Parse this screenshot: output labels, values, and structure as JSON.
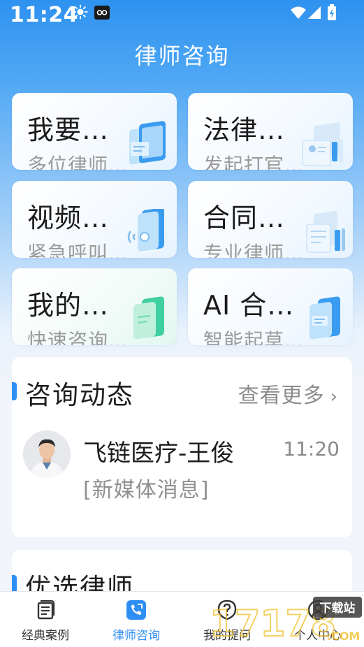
{
  "status_bar": {
    "time": "11:24"
  },
  "header": {
    "title": "律师咨询"
  },
  "tiles": [
    {
      "title": "我要…",
      "subtitle": "多位律师…"
    },
    {
      "title": "法律…",
      "subtitle": "发起打官…"
    },
    {
      "title": "视频…",
      "subtitle": "紧急呼叫…"
    },
    {
      "title": "合同…",
      "subtitle": "专业律师…"
    },
    {
      "title": "我的…",
      "subtitle": "快速咨询…"
    },
    {
      "title": "AI 合…",
      "subtitle": "智能起草…"
    }
  ],
  "consult_updates": {
    "title": "咨询动态",
    "more_label": "查看更多",
    "message": {
      "name": "飞链医疗-王俊",
      "time": "11:20",
      "text": "[新媒体消息]"
    }
  },
  "featured": {
    "title": "优选律师"
  },
  "tabbar": {
    "items": [
      {
        "label": "经典案例"
      },
      {
        "label": "律师咨询"
      },
      {
        "label": "我的提问"
      },
      {
        "label": "个人中心"
      }
    ]
  },
  "watermark": {
    "text": "17178",
    "badge": "下载站",
    "domain": ".COM"
  },
  "colors": {
    "primary": "#2f8ef3",
    "header_gradient_top": "#2e92f0"
  }
}
